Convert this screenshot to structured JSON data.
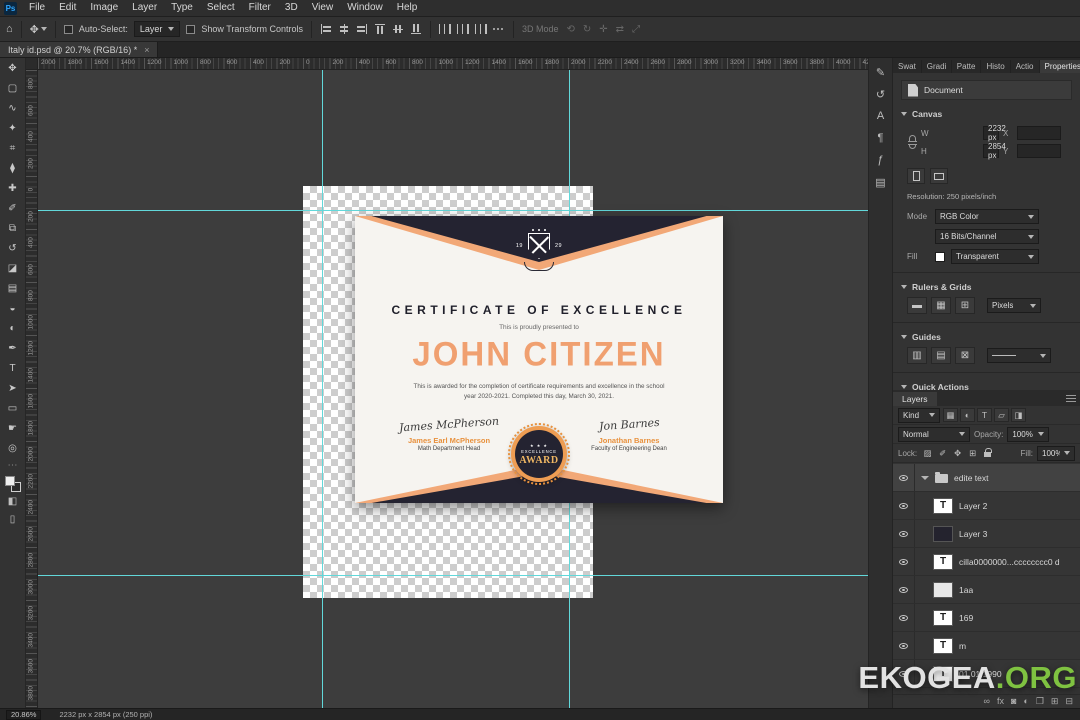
{
  "app": {
    "icon_label": "Ps",
    "menu": [
      "File",
      "Edit",
      "Image",
      "Layer",
      "Type",
      "Select",
      "Filter",
      "3D",
      "View",
      "Window",
      "Help"
    ],
    "options": {
      "auto_select_label": "Auto-Select:",
      "auto_select_value": "Layer",
      "show_transform_label": "Show Transform Controls",
      "mode_3d_label": "3D Mode"
    },
    "tab": {
      "title": "Italy id.psd @ 20.7% (RGB/16) *",
      "close": "×"
    },
    "status": {
      "zoom": "20.86%",
      "doc": "2232 px x 2854 px (250 ppi)"
    }
  },
  "rulers": {
    "top": [
      "2000",
      "1800",
      "1600",
      "1400",
      "1200",
      "1000",
      "800",
      "600",
      "400",
      "200",
      "0",
      "200",
      "400",
      "600",
      "800",
      "1000",
      "1200",
      "1400",
      "1600",
      "1800",
      "2000",
      "2200",
      "2400",
      "2600",
      "2800",
      "3000",
      "3200",
      "3400",
      "3600",
      "3800",
      "4000",
      "4200"
    ],
    "left": [
      "800",
      "600",
      "400",
      "200",
      "0",
      "200",
      "400",
      "600",
      "800",
      "1000",
      "1200",
      "1400",
      "1600",
      "1800",
      "2000",
      "2200",
      "2400",
      "2600",
      "2800",
      "3000",
      "3200",
      "3400",
      "3600",
      "3800"
    ]
  },
  "icons": {
    "toolbar": [
      "move",
      "rect-marquee",
      "lasso",
      "quick-select",
      "crop",
      "eyedropper",
      "spot-healing",
      "brush",
      "clone-stamp",
      "history-brush",
      "eraser",
      "gradient",
      "blur",
      "dodge",
      "pen",
      "type",
      "path-select",
      "shape",
      "hand",
      "zoom"
    ],
    "options_align": [
      "align-left",
      "align-h-center",
      "align-right",
      "align-top",
      "align-v-center",
      "align-bottom"
    ],
    "options_distribute": [
      "distribute-horizontal",
      "distribute-vertical",
      "distribute-gaps"
    ],
    "options_3d": [
      "3d-rotate",
      "3d-roll",
      "3d-pan",
      "3d-slide",
      "3d-scale"
    ],
    "right_strip": [
      "edit-pencil",
      "history",
      "character",
      "paragraph",
      "glyphs",
      "libraries"
    ],
    "layer_filters": [
      "filter-pixel",
      "filter-adjustment",
      "filter-type",
      "filter-shape",
      "filter-smart"
    ],
    "locks": [
      "lock-transparent",
      "lock-pixels",
      "lock-position",
      "lock-artboard",
      "lock-all"
    ],
    "rulers_grids": [
      "ruler-toggle",
      "grid-toggle",
      "snap-toggle"
    ],
    "guides_icons": [
      "new-guide-layout",
      "lock-guides",
      "clear-guides"
    ],
    "layers_footer": [
      "link-layers",
      "layer-effects",
      "layer-mask",
      "adjustment-layer",
      "layer-group",
      "new-layer",
      "delete-layer"
    ]
  },
  "panels": {
    "tabs": [
      "Swat",
      "Gradi",
      "Patte",
      "Histo",
      "Actio",
      "Properties"
    ],
    "properties": {
      "doc_label": "Document",
      "canvas_label": "Canvas",
      "w_label": "W",
      "w_value": "2232 px",
      "x_label": "X",
      "h_label": "H",
      "h_value": "2854 px",
      "y_label": "Y",
      "resolution": "Resolution: 250 pixels/inch",
      "mode_label": "Mode",
      "mode_value": "RGB Color",
      "depth_value": "16 Bits/Channel",
      "fill_label": "Fill",
      "fill_value": "Transparent",
      "rulers_grids_label": "Rulers & Grids",
      "rulers_unit_value": "Pixels",
      "guides_label": "Guides",
      "quick_actions_label": "Quick Actions"
    },
    "layers": {
      "tab_label": "Layers",
      "kind_label": "Kind",
      "blend_value": "Normal",
      "opacity_label": "Opacity:",
      "opacity_value": "100%",
      "lock_label": "Lock:",
      "fill_label": "Fill:",
      "fill_value": "100%",
      "rows": [
        {
          "kind": "group",
          "label": "edite text"
        },
        {
          "kind": "text",
          "label": "Layer 2"
        },
        {
          "kind": "image-dark",
          "label": "Layer 3"
        },
        {
          "kind": "text",
          "label": "cilla0000000...cccccccc0 d"
        },
        {
          "kind": "image-light",
          "label": "1aa"
        },
        {
          "kind": "text",
          "label": "169"
        },
        {
          "kind": "text",
          "label": "m"
        },
        {
          "kind": "text",
          "label": "01.01.1990"
        }
      ]
    }
  },
  "certificate": {
    "year_left": "19",
    "year_right": "29",
    "title": "CERTIFICATE OF EXCELLENCE",
    "subtitle": "This is proudly presented to",
    "name": "JOHN CITIZEN",
    "body1": "This is awarded for the completion of certificate requirements and excellence in the school",
    "body2": "year 2020-2021. Completed this day, March 30, 2021.",
    "sig_left_script": "James McPherson",
    "sig_left_name": "James Earl McPherson",
    "sig_left_title": "Math Department Head",
    "sig_right_script": "Jon Barnes",
    "sig_right_name": "Jonathan Barnes",
    "sig_right_title": "Faculty of Engineering Dean",
    "seal_stars": "★ ★ ★",
    "seal_line1": "EXCELLENCE",
    "seal_line2": "AWARD"
  },
  "watermark": {
    "left": "EKOGEA",
    "right": ".ORG"
  }
}
